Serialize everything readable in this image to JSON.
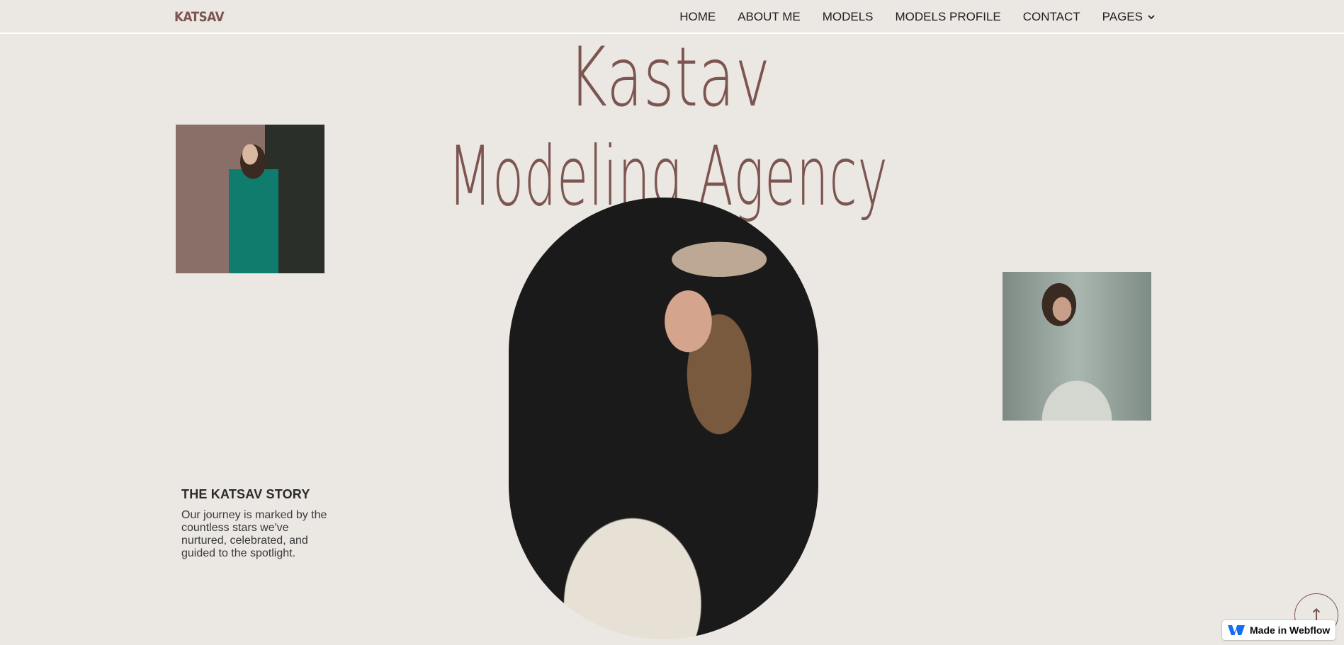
{
  "brand": {
    "logo": "KATSAV",
    "accent_color": "#7d5550",
    "background": "#ebe7e3"
  },
  "nav": {
    "items": [
      {
        "label": "HOME"
      },
      {
        "label": "ABOUT ME"
      },
      {
        "label": "MODELS"
      },
      {
        "label": "MODELS PROFILE"
      },
      {
        "label": "CONTACT"
      },
      {
        "label": "PAGES",
        "icon": "chevron-down-icon"
      }
    ]
  },
  "hero": {
    "title_line_1": "Kastav",
    "title_line_2": "Modeling Agency",
    "images": {
      "left": "model-green-coat-photo",
      "center": "model-hat-portrait-photo",
      "right": "model-hoodie-photo"
    }
  },
  "story": {
    "title": "THE KATSAV STORY",
    "body": "Our journey is marked by the countless stars we've nurtured, celebrated, and guided to the spotlight."
  },
  "scroll_top": {
    "icon": "arrow-up-icon",
    "glyph": "↑"
  },
  "badge": {
    "label": "Made in Webflow",
    "icon": "webflow-logo-icon"
  }
}
